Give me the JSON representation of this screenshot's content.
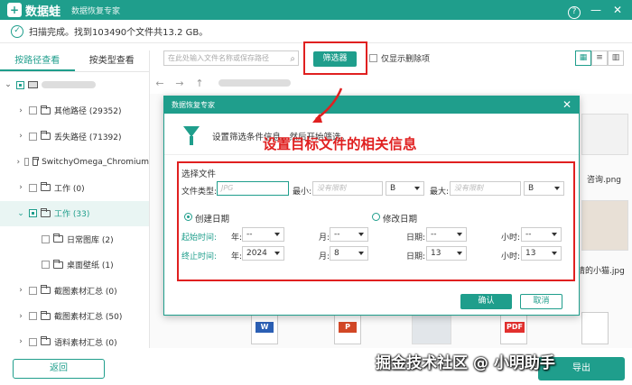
{
  "app": {
    "logo_mark": "+",
    "name": "数据蛙",
    "subtitle": "数据恢复专家"
  },
  "window": {
    "help": "?",
    "minimize": "—",
    "close": "✕"
  },
  "status": {
    "text": "扫描完成。找到103490个文件共13.2 GB。"
  },
  "sidebar": {
    "tabs": [
      "按路径查看",
      "按类型查看"
    ],
    "items": [
      {
        "label": "其他路径 (29352)"
      },
      {
        "label": "丢失路径 (71392)"
      },
      {
        "label": "SwitchyOmega_Chromium"
      },
      {
        "label": "工作 (0)"
      },
      {
        "label": "工作 (33)"
      },
      {
        "label": "日常图库 (2)"
      },
      {
        "label": "桌面壁纸 (1)"
      },
      {
        "label": "截图素材汇总 (0)"
      },
      {
        "label": "截图素材汇总 (50)"
      },
      {
        "label": "语料素材汇总 (0)"
      }
    ],
    "back_label": "返回"
  },
  "toolbar": {
    "search_placeholder": "在此处输入文件名称或保存路径",
    "filter_label": "筛选器",
    "only_deleted_label": "仅显示删除项"
  },
  "background": {
    "file_label_1": "咨询.png",
    "file_label_2": "睛的小猫.jpg",
    "ppt_badge": "P",
    "pdf_badge": "PDF",
    "word_badge": "W"
  },
  "dialog": {
    "title": "数据恢复专家",
    "close": "✕",
    "description": "设置筛选条件信息，然后开始筛选。",
    "annotation": "设置目标文件的相关信息",
    "select_file": "选择文件",
    "file_type_label": "文件类型:",
    "file_type_placeholder": "JPG",
    "min_label": "最小:",
    "min_placeholder": "没有限制",
    "min_unit": "B",
    "max_label": "最大:",
    "max_placeholder": "没有限制",
    "max_unit": "B",
    "created_date": "创建日期",
    "modified_date": "修改日期",
    "start_time": "起始时间:",
    "end_time": "终止时间:",
    "year": "年:",
    "month": "月:",
    "day": "日期:",
    "hour": "小时:",
    "start_year": "--",
    "start_month": "--",
    "start_day": "--",
    "start_hour": "--",
    "end_year": "2024",
    "end_month": "8",
    "end_day": "13",
    "end_hour": "13",
    "confirm": "确认",
    "cancel": "取消"
  },
  "watermark": "掘金技术社区 @ 小明助手",
  "export_label": "导出",
  "colors": {
    "accent": "#1f9e8c",
    "annotation": "#e02020"
  }
}
